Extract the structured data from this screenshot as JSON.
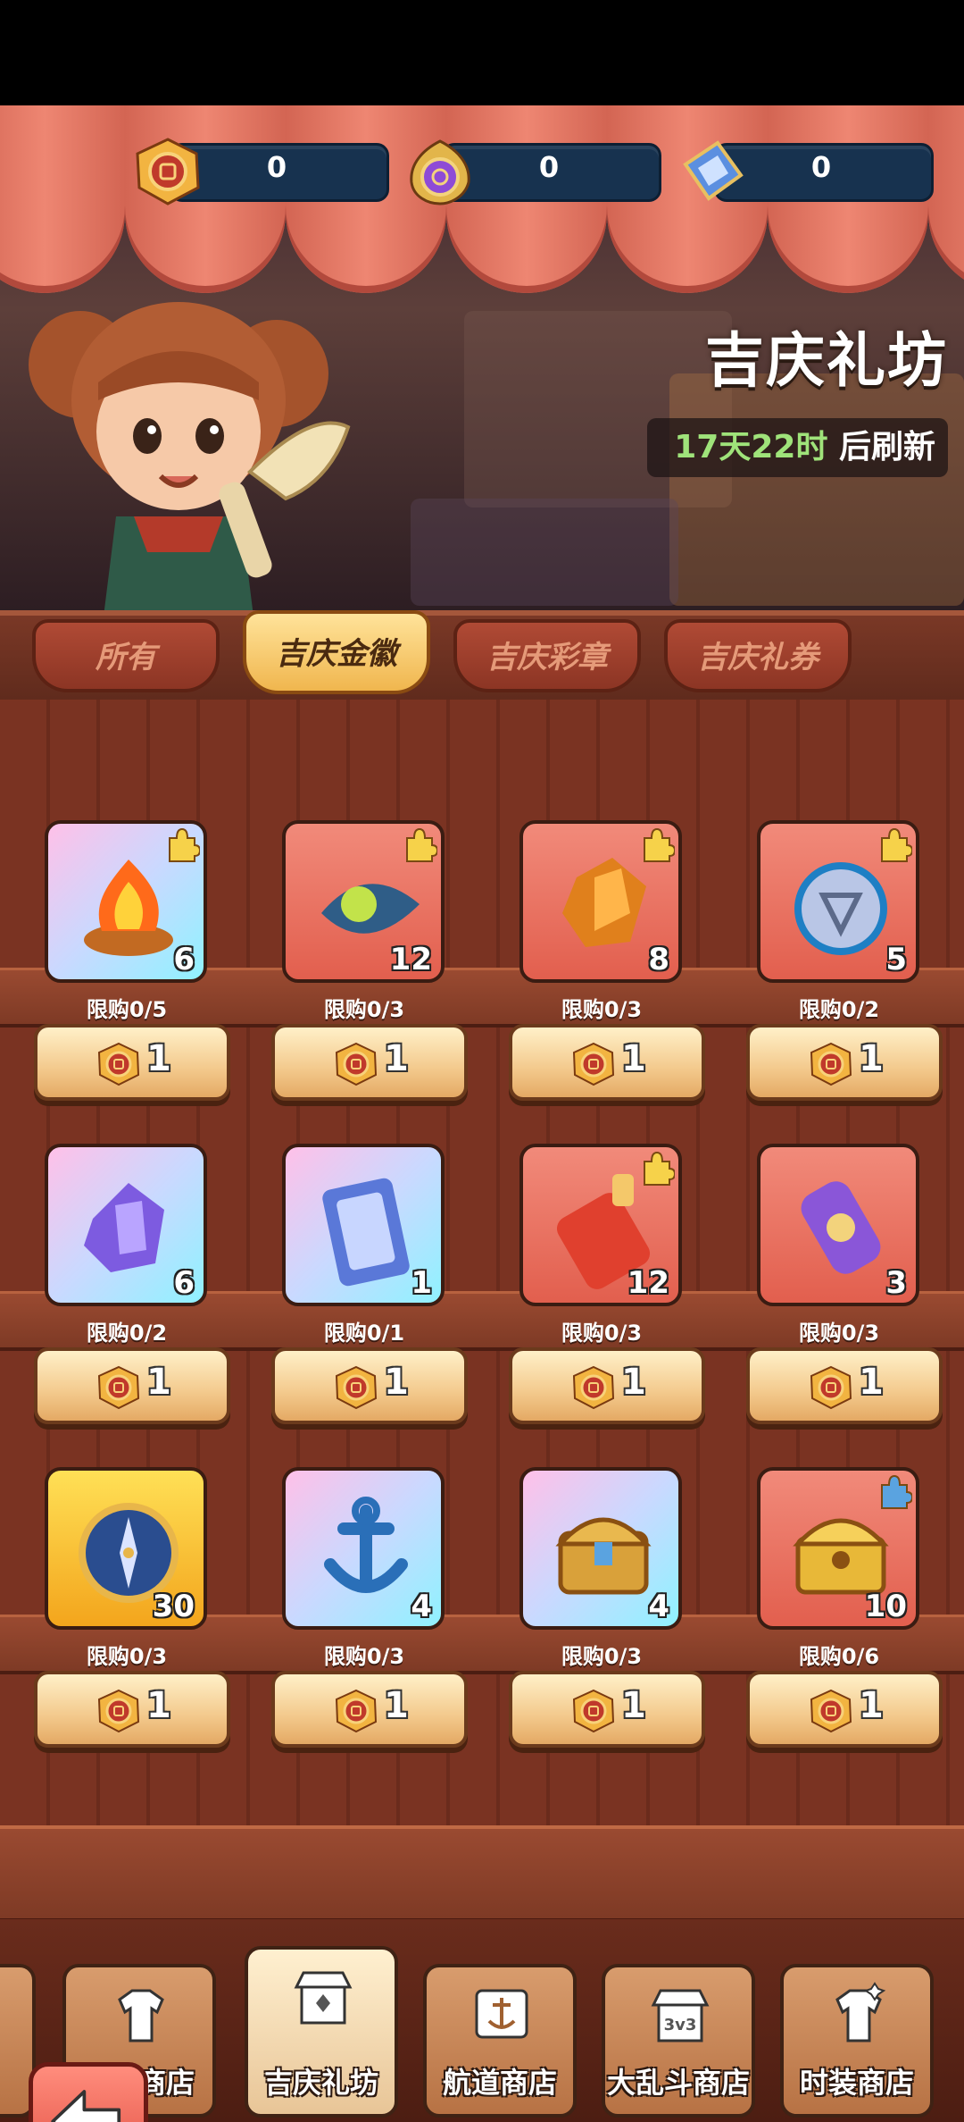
{
  "currencies": [
    {
      "name": "gold-badge-coin",
      "value": "0"
    },
    {
      "name": "purple-seal-coin",
      "value": "0"
    },
    {
      "name": "blue-ticket",
      "value": "0"
    }
  ],
  "shop": {
    "title": "吉庆礼坊",
    "refresh_time": "17天22时",
    "refresh_suffix": " 后刷新"
  },
  "tabs": [
    {
      "label": "所有",
      "active": false
    },
    {
      "label": "吉庆金徽",
      "active": true
    },
    {
      "label": "吉庆彩章",
      "active": false
    },
    {
      "label": "吉庆礼券",
      "active": false
    }
  ],
  "items": [
    {
      "icon": "fire-brazier-icon",
      "bg": "rain",
      "count": "6",
      "puzzle": "gold",
      "limit": "限购0/5",
      "price": "1"
    },
    {
      "icon": "pea-pod-icon",
      "bg": "red",
      "count": "12",
      "puzzle": "gold",
      "limit": "限购0/3",
      "price": "1"
    },
    {
      "icon": "amber-crystal-icon",
      "bg": "red",
      "count": "8",
      "puzzle": "gold",
      "limit": "限购0/3",
      "price": "1"
    },
    {
      "icon": "rune-amulet-icon",
      "bg": "red",
      "count": "5",
      "puzzle": "gold",
      "limit": "限购0/2",
      "price": "1"
    },
    {
      "icon": "purple-crystal-icon",
      "bg": "rain",
      "count": "6",
      "puzzle": "",
      "limit": "限购0/2",
      "price": "1"
    },
    {
      "icon": "spell-card-icon",
      "bg": "rain",
      "count": "1",
      "puzzle": "",
      "limit": "限购0/1",
      "price": "1"
    },
    {
      "icon": "potion-bottle-icon",
      "bg": "red",
      "count": "12",
      "puzzle": "gold",
      "limit": "限购0/3",
      "price": "1"
    },
    {
      "icon": "scroll-icon",
      "bg": "red",
      "count": "3",
      "puzzle": "",
      "limit": "限购0/3",
      "price": "1"
    },
    {
      "icon": "compass-icon",
      "bg": "gold",
      "count": "30",
      "puzzle": "",
      "limit": "限购0/3",
      "price": "1"
    },
    {
      "icon": "anchor-icon",
      "bg": "rain",
      "count": "4",
      "puzzle": "",
      "limit": "限购0/3",
      "price": "1"
    },
    {
      "icon": "treasure-chest-icon",
      "bg": "rain",
      "count": "4",
      "puzzle": "",
      "limit": "限购0/3",
      "price": "1"
    },
    {
      "icon": "golden-chest-icon",
      "bg": "red",
      "count": "10",
      "puzzle": "blue",
      "limit": "限购0/6",
      "price": "1"
    }
  ],
  "bottom_nav": [
    {
      "label": "商店",
      "icon": "shirt-icon",
      "active": false
    },
    {
      "label": "吉庆礼坊",
      "icon": "shop-stall-icon",
      "active": true
    },
    {
      "label": "航道商店",
      "icon": "anchor-flag-icon",
      "active": false
    },
    {
      "label": "大乱斗商店",
      "icon": "3v3-shop-icon",
      "active": false
    },
    {
      "label": "时装商店",
      "icon": "outfit-icon",
      "active": false
    }
  ],
  "colors": {
    "accent_green": "#9fe37a",
    "tab_active": "#f0b64e",
    "wood": "#7a3322"
  }
}
